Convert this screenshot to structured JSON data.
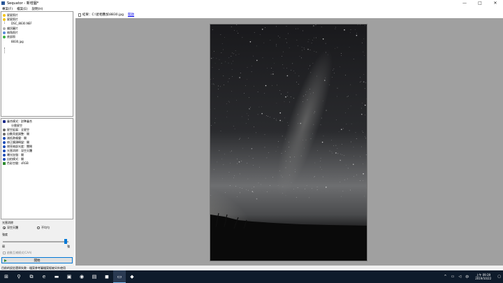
{
  "window": {
    "title": "Sequator - 新增圖*",
    "minimize": "—",
    "maximize": "□",
    "close": "✕"
  },
  "menu": [
    "專案(F)",
    "檔案(E)",
    "說明(H)"
  ],
  "tree": {
    "star_images": "星星照片",
    "star_file": "DSC_8830.NEF",
    "noise_images": "雜訊圖片",
    "vignette_images": "暗角照片",
    "base_image": "底部照",
    "base_file": "8830.jpg"
  },
  "settings": [
    {
      "icon": "merge-icon",
      "label": "疊合模式：對準疊合",
      "color": "#1b2a8a"
    },
    {
      "icon": "sky-region-icon",
      "label": "分層星空",
      "color": "#ffffff"
    },
    {
      "icon": "disk-icon",
      "label": "星空延展：全星空",
      "color": "#6a6a6a"
    },
    {
      "icon": "disk-icon",
      "label": "自動亮度調整：開",
      "color": "#6a6a6a"
    },
    {
      "icon": "globe-icon",
      "label": "減低熱噪聲：開",
      "color": "#1e4db7"
    },
    {
      "icon": "globe-icon",
      "label": "修正鏡頭畸變：開",
      "color": "#1e4db7"
    },
    {
      "icon": "globe-icon",
      "label": "增亮暗部光度：關閉",
      "color": "#1e4db7"
    },
    {
      "icon": "globe-icon",
      "label": "光害消除：深空天體",
      "color": "#1e4db7"
    },
    {
      "icon": "globe-icon",
      "label": "曝光加強：開",
      "color": "#1e4db7"
    },
    {
      "icon": "globe-icon",
      "label": "自拍模式：開",
      "color": "#1e4db7"
    },
    {
      "icon": "output-icon",
      "label": "色彩空間：sRGB",
      "color": "#2e8b2e"
    }
  ],
  "lower": {
    "group_title": "光害消除",
    "radio1": "深空天體",
    "radio2": "不均勻",
    "strength_label": "強度",
    "slider_min": "弱",
    "slider_max": "強",
    "slider_value": 0.96,
    "checkbox_label": "啟動互補模式(CAA)",
    "start_label": "開始"
  },
  "statusbar": "目前的設定還原失敗 - 檔案參考圖檔案經被另外使用",
  "output": {
    "label": "結果：C:\\星相疊加\\8830.jpg",
    "link": "開啟"
  },
  "taskbar": {
    "time": "上午 09:39",
    "date": "2019/10/22"
  }
}
